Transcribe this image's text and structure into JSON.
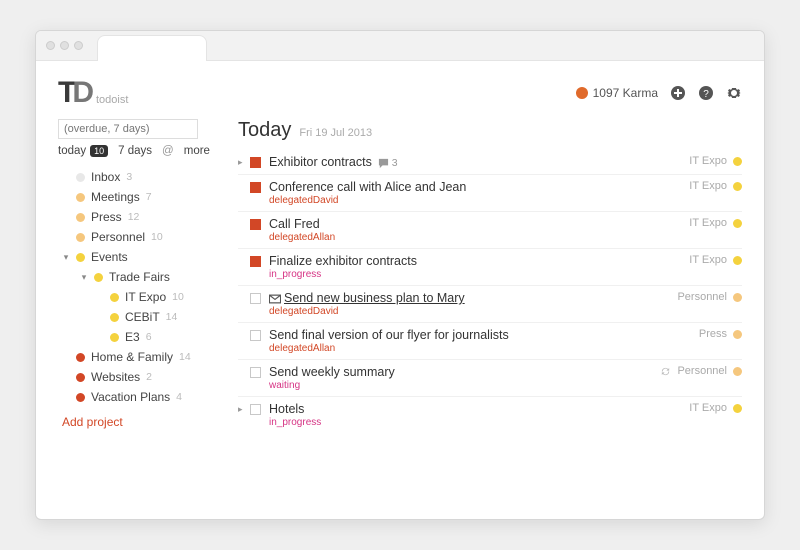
{
  "app_name": "todoist",
  "header": {
    "karma_value": "1097 Karma"
  },
  "sidebar": {
    "filter_value": "(overdue, 7 days)",
    "tabs": {
      "today": "today",
      "today_count": "10",
      "week": "7 days",
      "more": "more"
    },
    "projects": [
      {
        "name": "Inbox",
        "count": "3",
        "color": "#e8e8e8"
      },
      {
        "name": "Meetings",
        "count": "7",
        "color": "#f5c77e"
      },
      {
        "name": "Press",
        "count": "12",
        "color": "#f5c77e"
      },
      {
        "name": "Personnel",
        "count": "10",
        "color": "#f5c77e"
      },
      {
        "name": "Events",
        "count": "",
        "color": "#f4d23e",
        "expanded": true
      },
      {
        "name": "Trade Fairs",
        "count": "",
        "color": "#f4d23e",
        "level": 1,
        "expanded": true
      },
      {
        "name": "IT Expo",
        "count": "10",
        "color": "#f4d23e",
        "level": 2
      },
      {
        "name": "CEBiT",
        "count": "14",
        "color": "#f4d23e",
        "level": 2
      },
      {
        "name": "E3",
        "count": "6",
        "color": "#f4d23e",
        "level": 2
      },
      {
        "name": "Home & Family",
        "count": "14",
        "color": "#d24726"
      },
      {
        "name": "Websites",
        "count": "2",
        "color": "#d24726"
      },
      {
        "name": "Vacation Plans",
        "count": "4",
        "color": "#d24726"
      }
    ],
    "add_project": "Add project"
  },
  "main": {
    "title": "Today",
    "date": "Fri 19 Jul 2013",
    "tasks": [
      {
        "title": "Exhibitor contracts",
        "project": "IT Expo",
        "pcolor": "#f4d23e",
        "priority": true,
        "expandable": true,
        "comments": "3"
      },
      {
        "title": "Conference call with Alice and Jean",
        "sub": "delegatedDavid",
        "subc": "red",
        "project": "IT Expo",
        "pcolor": "#f4d23e",
        "priority": true
      },
      {
        "title": "Call Fred",
        "sub": "delegatedAllan",
        "subc": "red",
        "project": "IT Expo",
        "pcolor": "#f4d23e",
        "priority": true
      },
      {
        "title": "Finalize exhibitor contracts",
        "sub": "in_progress",
        "subc": "pink",
        "project": "IT Expo",
        "pcolor": "#f4d23e",
        "priority": true
      },
      {
        "title": "Send new business plan to Mary",
        "sub": "delegatedDavid",
        "subc": "red",
        "project": "Personnel",
        "pcolor": "#f5c77e",
        "mail": true,
        "underline": true
      },
      {
        "title": "Send final version of our flyer for journalists",
        "sub": "delegatedAllan",
        "subc": "red",
        "project": "Press",
        "pcolor": "#f5c77e"
      },
      {
        "title": "Send weekly summary",
        "sub": "waiting",
        "subc": "pink",
        "project": "Personnel",
        "pcolor": "#f5c77e",
        "recurring": true
      },
      {
        "title": "Hotels",
        "sub": "in_progress",
        "subc": "pink",
        "project": "IT Expo",
        "pcolor": "#f4d23e",
        "expandable": true
      }
    ]
  }
}
